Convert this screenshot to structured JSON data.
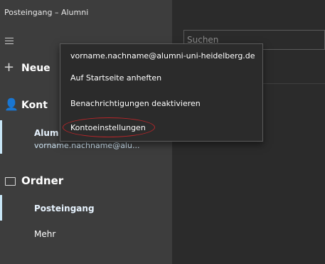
{
  "window": {
    "title": "Posteingang – Alumni"
  },
  "sidebar": {
    "new_label": "Neue",
    "accounts_label": "Kont",
    "account": {
      "name": "Alum",
      "email": "vorname.nachname@alu..."
    },
    "folders_label": "Ordner",
    "folders": [
      {
        "label": "Posteingang",
        "selected": true
      },
      {
        "label": "Mehr",
        "selected": false
      }
    ]
  },
  "search": {
    "placeholder": "Suchen"
  },
  "context_menu": {
    "items": [
      "vorname.nachname@alumni-uni-heidelberg.de",
      "Auf Startseite anheften",
      "Benachrichtigungen deaktivieren",
      "Kontoeinstellungen"
    ],
    "highlighted_index": 3
  },
  "colors": {
    "sidebar_bg": "#3d3d3d",
    "main_bg": "#2b2b2b",
    "selection_accent": "#c8e6f7",
    "highlight_ring": "#b8262a"
  }
}
